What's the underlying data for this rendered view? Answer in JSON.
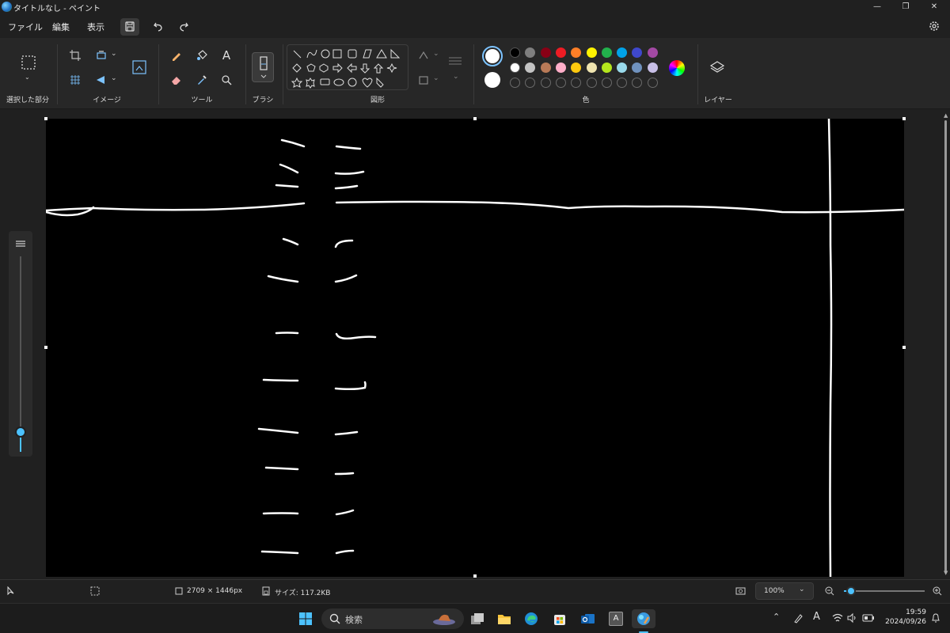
{
  "window": {
    "title": "タイトルなし - ペイント",
    "minimize": "—",
    "maximize": "❐",
    "close": "✕"
  },
  "menu": {
    "file": "ファイル",
    "edit": "編集",
    "view": "表示"
  },
  "ribbon": {
    "selection_label": "選択した部分",
    "image_label": "イメージ",
    "tools_label": "ツール",
    "brush_label": "ブラシ",
    "shapes_label": "図形",
    "colors_label": "色",
    "layers_label": "レイヤー",
    "text_tool": "A",
    "colors": {
      "primary": "#ffffff",
      "secondary": "#ffffff",
      "row1": [
        "#000000",
        "#7f7f7f",
        "#880015",
        "#ed1c24",
        "#ff7f27",
        "#fff200",
        "#22b14c",
        "#00a2e8",
        "#3f48cc",
        "#a349a4"
      ],
      "row2": [
        "#ffffff",
        "#c3c3c3",
        "#b97a57",
        "#ffaec9",
        "#ffc90e",
        "#efe4b0",
        "#b5e61d",
        "#99d9ea",
        "#7092be",
        "#c8bfe7"
      ]
    }
  },
  "status": {
    "dimensions": "2709 × 1446px",
    "size": "サイズ: 117.2KB",
    "zoom": "100%"
  },
  "taskbar": {
    "search_placeholder": "検索",
    "time": "19:59",
    "date": "2024/09/26",
    "ime": "A"
  }
}
